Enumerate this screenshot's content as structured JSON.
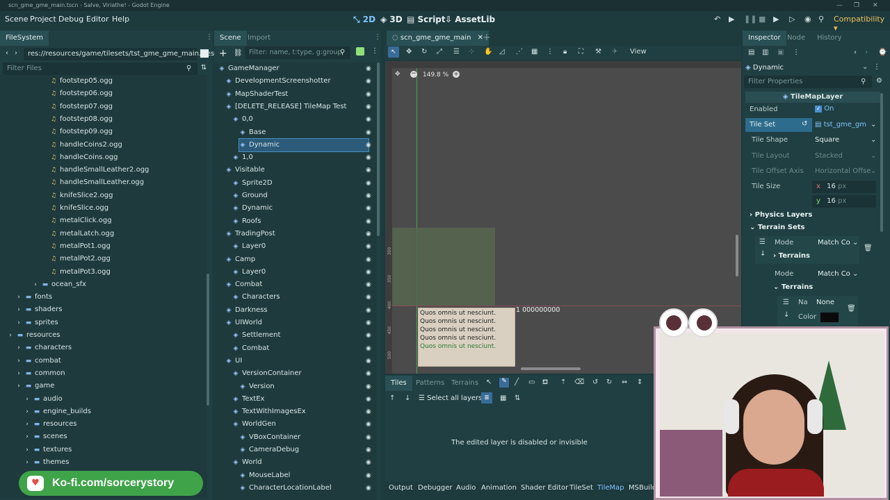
{
  "window": {
    "title": "scn_gme_gme_main.tscn - Salve, Viriathe! - Godot Engine"
  },
  "menu": {
    "items": [
      "Scene",
      "Project",
      "Debug",
      "Editor",
      "Help"
    ]
  },
  "workspaces": {
    "d2": "2D",
    "d3": "3D",
    "script": "Script",
    "assetlib": "AssetLib"
  },
  "renderer": "Compatibility",
  "filesystem": {
    "tab": "FileSystem",
    "path": "res://resources/game/tilesets/tst_gme_gme_main.tres",
    "filter_placeholder": "Filter Files",
    "items": [
      {
        "label": "footstep05.ogg",
        "kind": "audio",
        "indent": 4
      },
      {
        "label": "footstep06.ogg",
        "kind": "audio",
        "indent": 4
      },
      {
        "label": "footstep07.ogg",
        "kind": "audio",
        "indent": 4
      },
      {
        "label": "footstep08.ogg",
        "kind": "audio",
        "indent": 4
      },
      {
        "label": "footstep09.ogg",
        "kind": "audio",
        "indent": 4
      },
      {
        "label": "handleCoins2.ogg",
        "kind": "audio",
        "indent": 4
      },
      {
        "label": "handleCoins.ogg",
        "kind": "audio",
        "indent": 4
      },
      {
        "label": "handleSmallLeather2.ogg",
        "kind": "audio",
        "indent": 4
      },
      {
        "label": "handleSmallLeather.ogg",
        "kind": "audio",
        "indent": 4
      },
      {
        "label": "knifeSlice2.ogg",
        "kind": "audio",
        "indent": 4
      },
      {
        "label": "knifeSlice.ogg",
        "kind": "audio",
        "indent": 4
      },
      {
        "label": "metalClick.ogg",
        "kind": "audio",
        "indent": 4
      },
      {
        "label": "metalLatch.ogg",
        "kind": "audio",
        "indent": 4
      },
      {
        "label": "metalPot1.ogg",
        "kind": "audio",
        "indent": 4
      },
      {
        "label": "metalPot2.ogg",
        "kind": "audio",
        "indent": 4
      },
      {
        "label": "metalPot3.ogg",
        "kind": "audio",
        "indent": 4
      },
      {
        "label": "ocean_sfx",
        "kind": "folder",
        "indent": 3
      },
      {
        "label": "fonts",
        "kind": "folder",
        "indent": 1
      },
      {
        "label": "shaders",
        "kind": "folder",
        "indent": 1
      },
      {
        "label": "sprites",
        "kind": "folder",
        "indent": 1
      },
      {
        "label": "resources",
        "kind": "folder",
        "indent": 0
      },
      {
        "label": "characters",
        "kind": "folder",
        "indent": 1
      },
      {
        "label": "combat",
        "kind": "folder",
        "indent": 1
      },
      {
        "label": "common",
        "kind": "folder",
        "indent": 1
      },
      {
        "label": "game",
        "kind": "folder",
        "indent": 1
      },
      {
        "label": "audio",
        "kind": "folder",
        "indent": 2
      },
      {
        "label": "engine_builds",
        "kind": "folder",
        "indent": 2
      },
      {
        "label": "resources",
        "kind": "folder",
        "indent": 2
      },
      {
        "label": "scenes",
        "kind": "folder",
        "indent": 2
      },
      {
        "label": "textures",
        "kind": "folder",
        "indent": 2
      },
      {
        "label": "themes",
        "kind": "folder",
        "indent": 2
      }
    ]
  },
  "kofi": "Ko-fi.com/sorcerystory",
  "scene": {
    "tabs": [
      "Scene",
      "Import"
    ],
    "filter_placeholder": "Filter: name, t:type, g:group",
    "nodes": [
      {
        "label": "GameManager",
        "indent": 0
      },
      {
        "label": "DevelopmentScreenshotter",
        "indent": 1
      },
      {
        "label": "MapShaderTest",
        "indent": 1
      },
      {
        "label": "[DELETE_RELEASE] TileMap Test",
        "indent": 1
      },
      {
        "label": "0,0",
        "indent": 2
      },
      {
        "label": "Base",
        "indent": 3
      },
      {
        "label": "Dynamic",
        "indent": 3,
        "selected": true
      },
      {
        "label": "1,0",
        "indent": 2
      },
      {
        "label": "Visitable",
        "indent": 1
      },
      {
        "label": "Sprite2D",
        "indent": 2
      },
      {
        "label": "Ground",
        "indent": 2
      },
      {
        "label": "Dynamic",
        "indent": 2
      },
      {
        "label": "Roofs",
        "indent": 2
      },
      {
        "label": "TradingPost",
        "indent": 1
      },
      {
        "label": "Layer0",
        "indent": 2
      },
      {
        "label": "Camp",
        "indent": 1
      },
      {
        "label": "Layer0",
        "indent": 2
      },
      {
        "label": "Combat",
        "indent": 1
      },
      {
        "label": "Characters",
        "indent": 2
      },
      {
        "label": "Darkness",
        "indent": 1
      },
      {
        "label": "UIWorld",
        "indent": 1
      },
      {
        "label": "Settlement",
        "indent": 2
      },
      {
        "label": "Combat",
        "indent": 2
      },
      {
        "label": "UI",
        "indent": 1
      },
      {
        "label": "VersionContainer",
        "indent": 2
      },
      {
        "label": "Version",
        "indent": 3
      },
      {
        "label": "TextEx",
        "indent": 2
      },
      {
        "label": "TextWithImagesEx",
        "indent": 2
      },
      {
        "label": "WorldGen",
        "indent": 2
      },
      {
        "label": "VBoxContainer",
        "indent": 3
      },
      {
        "label": "CameraDebug",
        "indent": 3
      },
      {
        "label": "World",
        "indent": 2
      },
      {
        "label": "MouseLabel",
        "indent": 3
      },
      {
        "label": "CharacterLocationLabel",
        "indent": 3
      }
    ]
  },
  "viewport": {
    "scene_tab": "scn_gme_gme_main",
    "view_label": "View",
    "zoom": "149.8 %",
    "coord_label": "1 000000000",
    "sample_lines": [
      "Quos omnis ut nesciunt.",
      "Quos omnis ut nesciunt.",
      "Quos omnis ut nesciunt.",
      "Quos omnis ut nesciunt.",
      "Quos omnis ut nesciunt."
    ],
    "ruler_v": [
      "300",
      "350",
      "400",
      "450",
      "500"
    ]
  },
  "tilemap_panel": {
    "tabs": [
      "Tiles",
      "Patterns",
      "Terrains"
    ],
    "select_all": "Select all layers",
    "message": "The edited layer is disabled or invisible"
  },
  "bottom_tabs": [
    "Output",
    "Debugger",
    "Audio",
    "Animation",
    "Shader Editor",
    "TileSet",
    "TileMap",
    "MSBuild"
  ],
  "inspector": {
    "tabs": [
      "Inspector",
      "Node",
      "History"
    ],
    "object": "Dynamic",
    "filter_placeholder": "Filter Properties",
    "class_name": "TileMapLayer",
    "enabled_label": "Enabled",
    "enabled_value": "On",
    "tileset_label": "Tile Set",
    "tileset_value": "tst_gme_gm",
    "props": [
      {
        "label": "Tile Shape",
        "value": "Square",
        "dim": false
      },
      {
        "label": "Tile Layout",
        "value": "Stacked",
        "dim": true
      },
      {
        "label": "Tile Offset Axis",
        "value": "Horizontal Offse",
        "dim": true
      },
      {
        "label": "Tile Size",
        "value": "",
        "dim": false
      }
    ],
    "tile_size": {
      "x_label": "x",
      "x": "16",
      "y_label": "y",
      "y": "16",
      "unit": "px"
    },
    "physics_layers": "Physics Layers",
    "terrain_sets": "Terrain Sets",
    "mode_label": "Mode",
    "mode_value": "Match Co",
    "terrains": "Terrains",
    "name_label": "Na",
    "name_value": "None",
    "color_label": "Color"
  }
}
